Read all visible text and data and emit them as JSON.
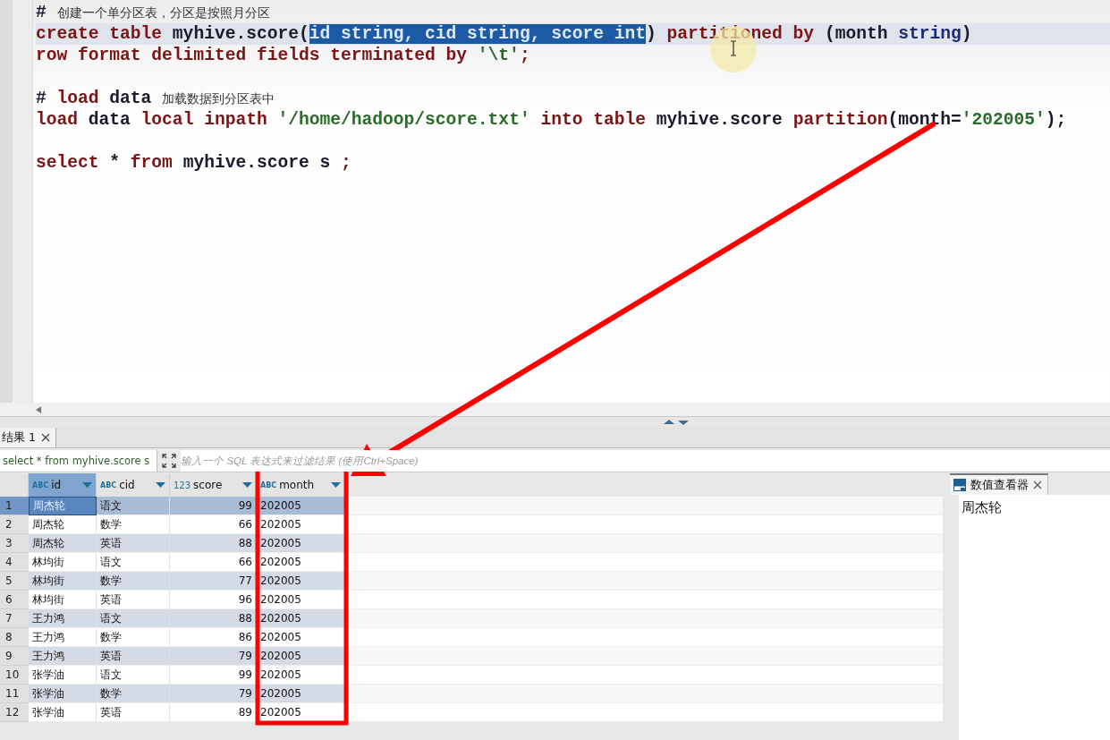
{
  "editor": {
    "lines": [
      {
        "current": false,
        "gap_before": false,
        "tokens": [
          {
            "text": "# ",
            "kind": "id"
          },
          {
            "text": "创建一个单分区表，分区是按照月分区",
            "kind": "cm"
          }
        ]
      },
      {
        "current": true,
        "gap_before": false,
        "tokens": [
          {
            "text": "create table ",
            "kind": "kw"
          },
          {
            "text": "myhive.score(",
            "kind": "id"
          },
          {
            "text": "id string, cid string, score int",
            "kind": "sel"
          },
          {
            "text": ") ",
            "kind": "id"
          },
          {
            "text": "partitioned by ",
            "kind": "kw"
          },
          {
            "text": "(month ",
            "kind": "id"
          },
          {
            "text": "string",
            "kind": "type"
          },
          {
            "text": ")",
            "kind": "id"
          }
        ]
      },
      {
        "current": false,
        "gap_before": false,
        "tokens": [
          {
            "text": "row format delimited fields terminated by ",
            "kind": "kw"
          },
          {
            "text": "'\\t'",
            "kind": "str"
          },
          {
            "text": ";",
            "kind": "kw"
          }
        ]
      },
      {
        "current": false,
        "gap_before": true,
        "tokens": [
          {
            "text": "# ",
            "kind": "id"
          },
          {
            "text": "load ",
            "kind": "kw"
          },
          {
            "text": "data ",
            "kind": "id"
          },
          {
            "text": "加载数据到分区表中",
            "kind": "cm"
          }
        ]
      },
      {
        "current": false,
        "gap_before": false,
        "tokens": [
          {
            "text": "load ",
            "kind": "kw"
          },
          {
            "text": "data ",
            "kind": "id"
          },
          {
            "text": "local inpath ",
            "kind": "kw"
          },
          {
            "text": "'/home/hadoop/score.txt'",
            "kind": "str"
          },
          {
            "text": " into table ",
            "kind": "kw"
          },
          {
            "text": "myhive.score ",
            "kind": "id"
          },
          {
            "text": "partition",
            "kind": "kw"
          },
          {
            "text": "(month=",
            "kind": "id"
          },
          {
            "text": "'202005'",
            "kind": "str"
          },
          {
            "text": ");",
            "kind": "id"
          }
        ]
      },
      {
        "current": false,
        "gap_before": true,
        "tokens": [
          {
            "text": "select ",
            "kind": "kw"
          },
          {
            "text": "* ",
            "kind": "id"
          },
          {
            "text": "from ",
            "kind": "kw"
          },
          {
            "text": "myhive.score s ",
            "kind": "id"
          },
          {
            "text": ";",
            "kind": "kw"
          }
        ]
      }
    ]
  },
  "results": {
    "tab": {
      "label": "结果 1",
      "selected": true
    },
    "query": "select * from myhive.score s",
    "filter_placeholder": "输入一个 SQL 表达式来过滤结果 (使用Ctrl+Space)",
    "columns": [
      {
        "type_label": "ABC",
        "name": "id",
        "kind": "text",
        "selected": true
      },
      {
        "type_label": "ABC",
        "name": "cid",
        "kind": "text",
        "selected": false
      },
      {
        "type_label": "123",
        "name": "score",
        "kind": "number",
        "selected": false
      },
      {
        "type_label": "ABC",
        "name": "month",
        "kind": "text",
        "selected": false
      }
    ],
    "rows": [
      {
        "number": "1",
        "cells": [
          "周杰轮",
          "语文",
          "99",
          "202005"
        ],
        "selected": true
      },
      {
        "number": "2",
        "cells": [
          "周杰轮",
          "数学",
          "66",
          "202005"
        ],
        "selected": false
      },
      {
        "number": "3",
        "cells": [
          "周杰轮",
          "英语",
          "88",
          "202005"
        ],
        "selected": false
      },
      {
        "number": "4",
        "cells": [
          "林均街",
          "语文",
          "66",
          "202005"
        ],
        "selected": false
      },
      {
        "number": "5",
        "cells": [
          "林均街",
          "数学",
          "77",
          "202005"
        ],
        "selected": false
      },
      {
        "number": "6",
        "cells": [
          "林均街",
          "英语",
          "96",
          "202005"
        ],
        "selected": false
      },
      {
        "number": "7",
        "cells": [
          "王力鸿",
          "语文",
          "88",
          "202005"
        ],
        "selected": false
      },
      {
        "number": "8",
        "cells": [
          "王力鸿",
          "数学",
          "86",
          "202005"
        ],
        "selected": false
      },
      {
        "number": "9",
        "cells": [
          "王力鸿",
          "英语",
          "79",
          "202005"
        ],
        "selected": false
      },
      {
        "number": "10",
        "cells": [
          "张学油",
          "语文",
          "99",
          "202005"
        ],
        "selected": false
      },
      {
        "number": "11",
        "cells": [
          "张学油",
          "数学",
          "79",
          "202005"
        ],
        "selected": false
      },
      {
        "number": "12",
        "cells": [
          "张学油",
          "英语",
          "89",
          "202005"
        ],
        "selected": false
      }
    ]
  },
  "value_viewer": {
    "tab": "数值查看器",
    "value": "周杰轮"
  }
}
